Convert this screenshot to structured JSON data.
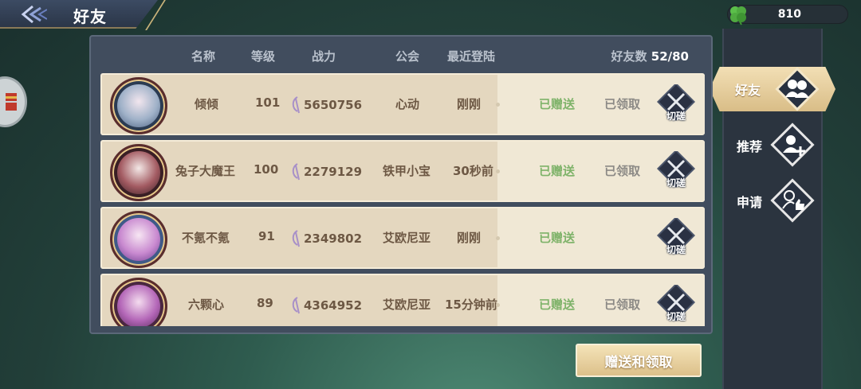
{
  "header": {
    "title": "好友",
    "back_icon": "back-arrow-icon"
  },
  "currency": {
    "icon": "clover-icon",
    "value": "810"
  },
  "columns": {
    "name": "名称",
    "level": "等级",
    "power": "战力",
    "guild": "公会",
    "last_login": "最近登陆",
    "friend_count_label": "好友数",
    "friend_count": "52/80"
  },
  "friends": [
    {
      "name": "倾倾",
      "level": "101",
      "power": "5650756",
      "guild": "心动",
      "last_login": "刚刚",
      "sent": "已赠送",
      "claimed": "已领取",
      "spar": "切磋",
      "avatar_color": "#7c8fa8"
    },
    {
      "name": "兔子大魔王",
      "level": "100",
      "power": "2279129",
      "guild": "铁甲小宝",
      "last_login": "30秒前",
      "sent": "已赠送",
      "claimed": "已领取",
      "spar": "切磋",
      "avatar_color": "#7a3a44"
    },
    {
      "name": "不氪不氪",
      "level": "91",
      "power": "2349802",
      "guild": "艾欧尼亚",
      "last_login": "刚刚",
      "sent": "已赠送",
      "claimed": "",
      "spar": "切磋",
      "avatar_color": "#b46fb8"
    },
    {
      "name": "六颗心",
      "level": "89",
      "power": "4364952",
      "guild": "艾欧尼亚",
      "last_login": "15分钟前",
      "sent": "已赠送",
      "claimed": "已领取",
      "spar": "切磋",
      "avatar_color": "#9a4f9a"
    }
  ],
  "nav": {
    "friends": {
      "label": "好友",
      "icon": "friends-icon"
    },
    "recommend": {
      "label": "推荐",
      "icon": "add-friend-icon"
    },
    "apply": {
      "label": "申请",
      "icon": "request-thumbs-up-icon"
    }
  },
  "action_button": {
    "label": "赠送和领取"
  },
  "colors": {
    "accent_gold": "#dcc08a",
    "sent_green": "#7fb36a",
    "panel": "#414d5e"
  }
}
